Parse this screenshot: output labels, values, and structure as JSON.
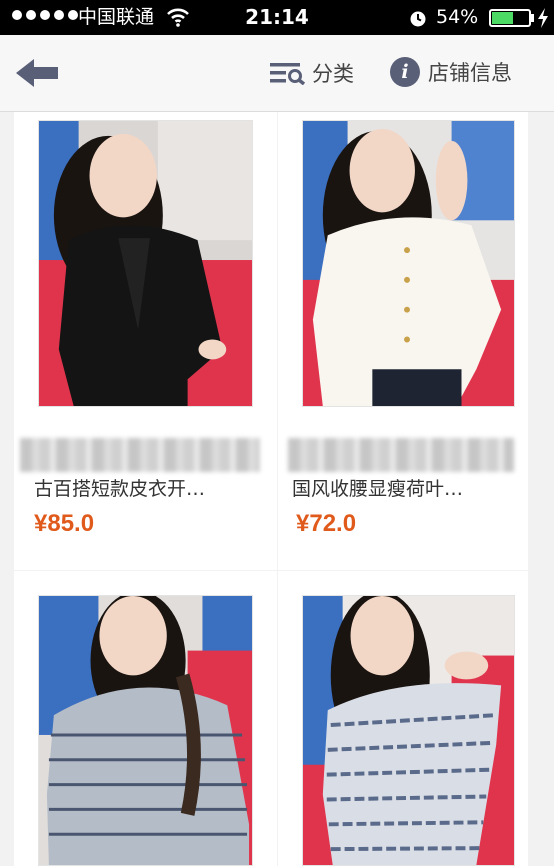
{
  "status_bar": {
    "carrier": "中国联通",
    "time": "21:14",
    "battery_percent": "54%",
    "battery_level": 0.54
  },
  "nav": {
    "category_label": "分类",
    "shop_info_label": "店铺信息"
  },
  "products": [
    {
      "title": "古百搭短款皮衣开…",
      "price": "¥85.0"
    },
    {
      "title": "国风收腰显瘦荷叶…",
      "price": "¥72.0"
    },
    {
      "title": "",
      "price": ""
    },
    {
      "title": "",
      "price": ""
    }
  ],
  "colors": {
    "price": "#e05a1c",
    "icon": "#5a5f78",
    "battery": "#4cd964"
  }
}
